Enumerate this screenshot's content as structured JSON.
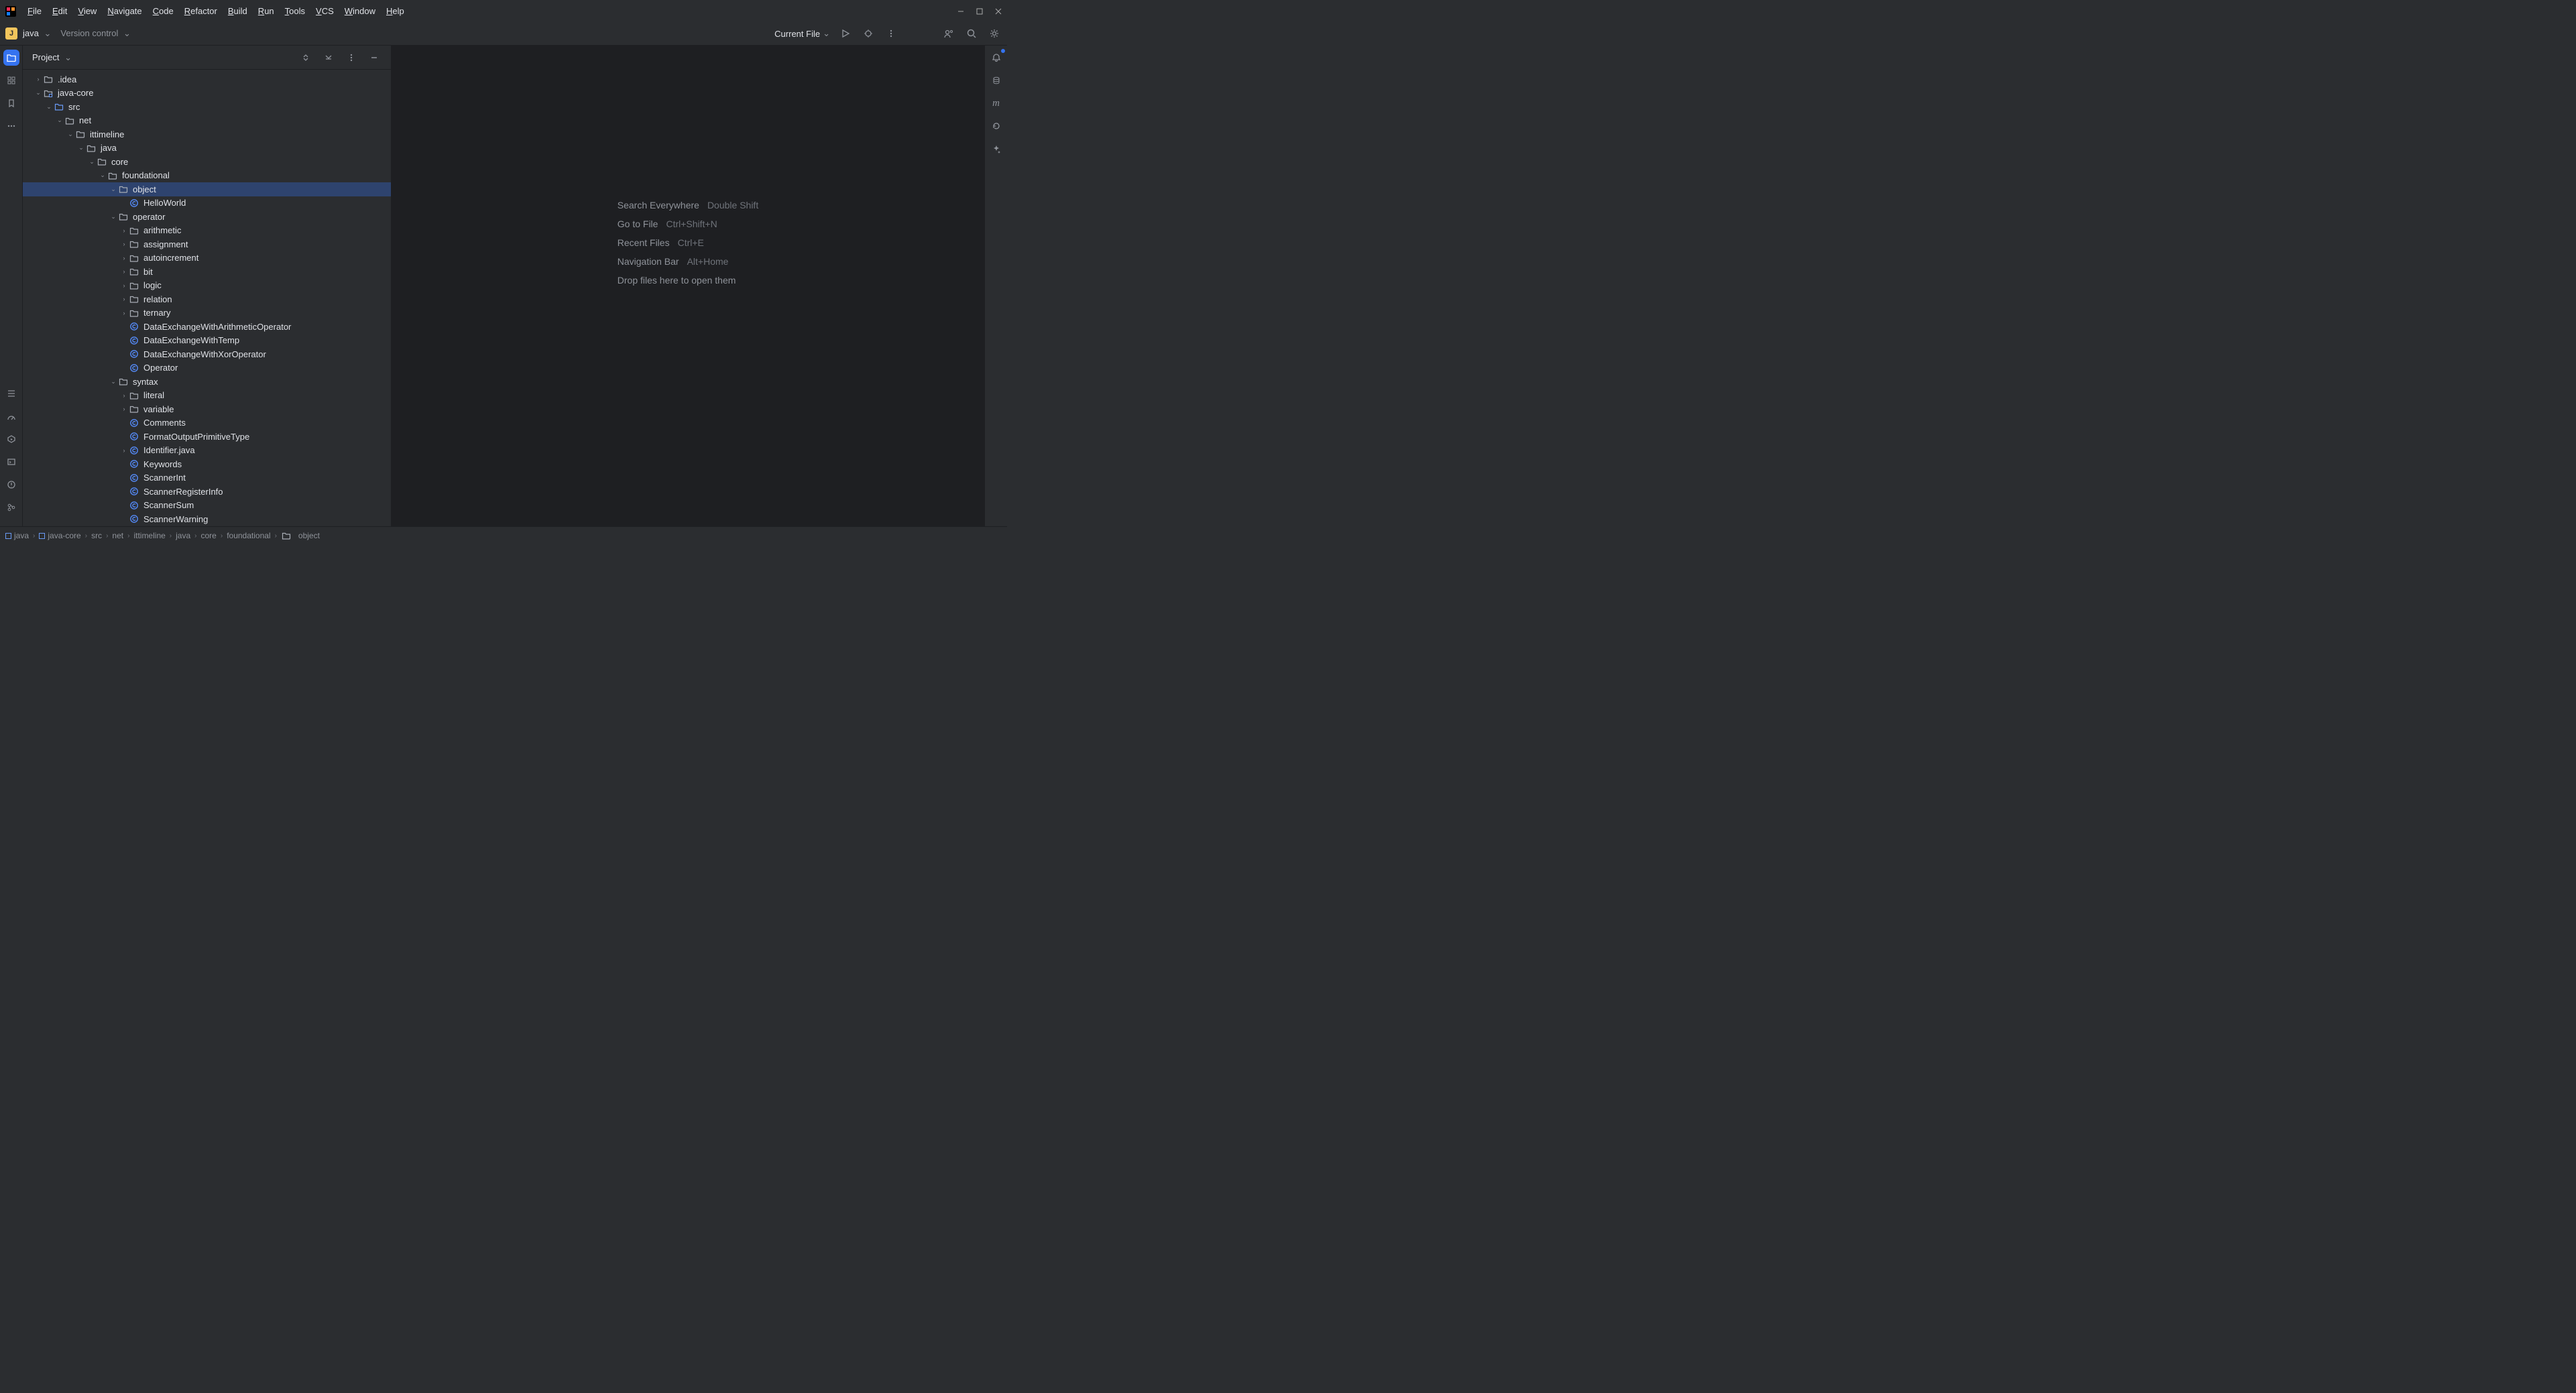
{
  "menu": [
    "File",
    "Edit",
    "View",
    "Navigate",
    "Code",
    "Refactor",
    "Build",
    "Run",
    "Tools",
    "VCS",
    "Window",
    "Help"
  ],
  "toolbar": {
    "project_badge": "J",
    "project_name": "java",
    "vcs": "Version control",
    "run_config": "Current File"
  },
  "panel": {
    "title": "Project"
  },
  "tree": [
    {
      "d": 0,
      "a": "r",
      "i": "folder",
      "l": ".idea"
    },
    {
      "d": 0,
      "a": "d",
      "i": "module",
      "l": "java-core"
    },
    {
      "d": 1,
      "a": "d",
      "i": "source",
      "l": "src"
    },
    {
      "d": 2,
      "a": "d",
      "i": "folder",
      "l": "net"
    },
    {
      "d": 3,
      "a": "d",
      "i": "folder",
      "l": "ittimeline"
    },
    {
      "d": 4,
      "a": "d",
      "i": "folder",
      "l": "java"
    },
    {
      "d": 5,
      "a": "d",
      "i": "folder",
      "l": "core"
    },
    {
      "d": 6,
      "a": "d",
      "i": "folder",
      "l": "foundational"
    },
    {
      "d": 7,
      "a": "d",
      "i": "folder",
      "l": "object",
      "sel": true
    },
    {
      "d": 8,
      "a": "",
      "i": "class",
      "l": "HelloWorld"
    },
    {
      "d": 7,
      "a": "d",
      "i": "folder",
      "l": "operator"
    },
    {
      "d": 8,
      "a": "r",
      "i": "folder",
      "l": "arithmetic"
    },
    {
      "d": 8,
      "a": "r",
      "i": "folder",
      "l": "assignment"
    },
    {
      "d": 8,
      "a": "r",
      "i": "folder",
      "l": "autoincrement"
    },
    {
      "d": 8,
      "a": "r",
      "i": "folder",
      "l": "bit"
    },
    {
      "d": 8,
      "a": "r",
      "i": "folder",
      "l": "logic"
    },
    {
      "d": 8,
      "a": "r",
      "i": "folder",
      "l": "relation"
    },
    {
      "d": 8,
      "a": "r",
      "i": "folder",
      "l": "ternary"
    },
    {
      "d": 8,
      "a": "",
      "i": "class",
      "l": "DataExchangeWithArithmeticOperator"
    },
    {
      "d": 8,
      "a": "",
      "i": "class",
      "l": "DataExchangeWithTemp"
    },
    {
      "d": 8,
      "a": "",
      "i": "class",
      "l": "DataExchangeWithXorOperator"
    },
    {
      "d": 8,
      "a": "",
      "i": "class",
      "l": "Operator"
    },
    {
      "d": 7,
      "a": "d",
      "i": "folder",
      "l": "syntax"
    },
    {
      "d": 8,
      "a": "r",
      "i": "folder",
      "l": "literal"
    },
    {
      "d": 8,
      "a": "r",
      "i": "folder",
      "l": "variable"
    },
    {
      "d": 8,
      "a": "",
      "i": "class",
      "l": "Comments"
    },
    {
      "d": 8,
      "a": "",
      "i": "class",
      "l": "FormatOutputPrimitiveType"
    },
    {
      "d": 8,
      "a": "r",
      "i": "class",
      "l": "Identifier.java"
    },
    {
      "d": 8,
      "a": "",
      "i": "class",
      "l": "Keywords"
    },
    {
      "d": 8,
      "a": "",
      "i": "class",
      "l": "ScannerInt"
    },
    {
      "d": 8,
      "a": "",
      "i": "class",
      "l": "ScannerRegisterInfo"
    },
    {
      "d": 8,
      "a": "",
      "i": "class",
      "l": "ScannerSum"
    },
    {
      "d": 8,
      "a": "",
      "i": "class",
      "l": "ScannerWarning"
    }
  ],
  "hints": [
    {
      "label": "Search Everywhere",
      "shortcut": "Double Shift"
    },
    {
      "label": "Go to File",
      "shortcut": "Ctrl+Shift+N"
    },
    {
      "label": "Recent Files",
      "shortcut": "Ctrl+E"
    },
    {
      "label": "Navigation Bar",
      "shortcut": "Alt+Home"
    },
    {
      "label": "Drop files here to open them",
      "shortcut": ""
    }
  ],
  "breadcrumb": [
    {
      "i": "sq",
      "l": "java"
    },
    {
      "i": "sq",
      "l": "java-core"
    },
    {
      "i": "",
      "l": "src"
    },
    {
      "i": "",
      "l": "net"
    },
    {
      "i": "",
      "l": "ittimeline"
    },
    {
      "i": "",
      "l": "java"
    },
    {
      "i": "",
      "l": "core"
    },
    {
      "i": "",
      "l": "foundational"
    },
    {
      "i": "folder",
      "l": "object"
    }
  ]
}
